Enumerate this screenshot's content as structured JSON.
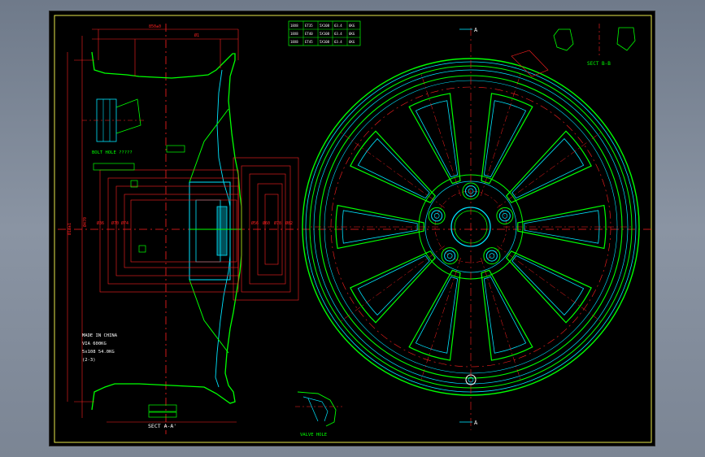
{
  "drawing": {
    "section_aa_title": "SECT A-A'",
    "section_bb_title": "SECT B-B",
    "bolt_hole_label": "BOLT HOLE ?????",
    "valve_hole_label": "VALVE HOLE",
    "marking_lines": [
      "MADE IN CHINA",
      "VIA 600KG",
      "5x108 54.0KG",
      "(2-3)"
    ],
    "cut_marker_top": "A",
    "cut_marker_bottom": "A"
  },
  "spec_table": {
    "rows": [
      [
        "18X8",
        "ET35",
        "5X108",
        "63.4",
        "6KG"
      ],
      [
        "18X8",
        "ET40",
        "5X108",
        "63.4",
        "6KG"
      ],
      [
        "18X8",
        "ET45",
        "5X108",
        "63.4",
        "6KG"
      ]
    ]
  },
  "colors": {
    "background": "#000000",
    "border": "#e8e84a",
    "outline": "#00ff00",
    "detail": "#00e5ff",
    "dimension": "#ff2020",
    "text": "#ffffff"
  }
}
